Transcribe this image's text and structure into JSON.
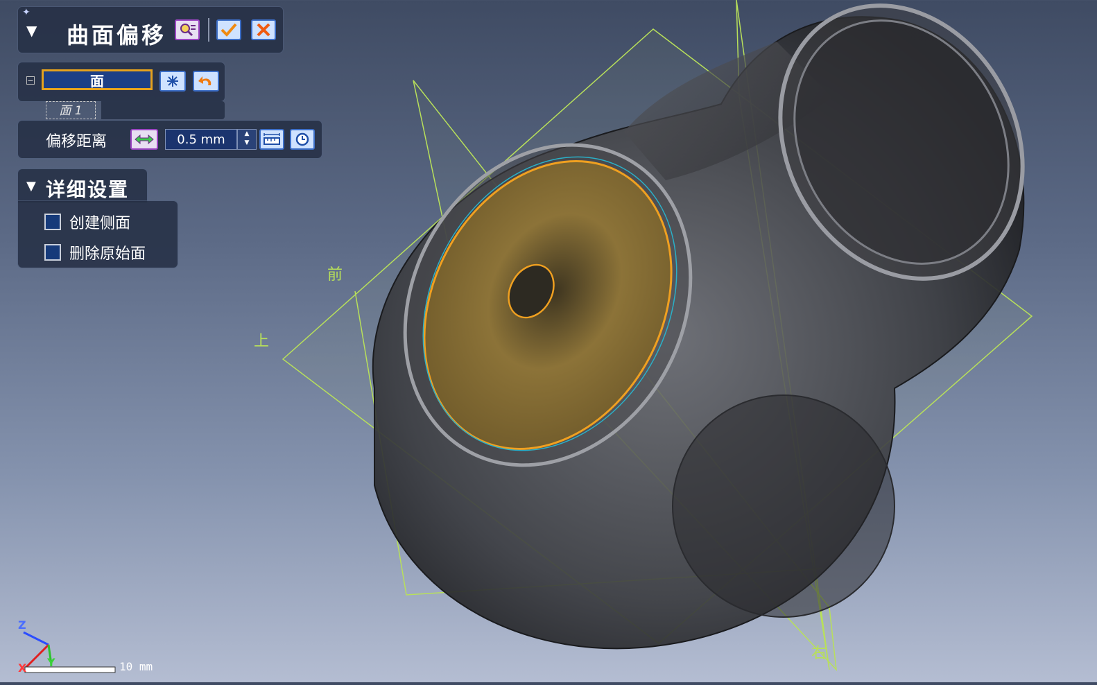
{
  "command": {
    "title": "曲面偏移",
    "preview_icon": "preview-magnifier-icon",
    "ok_icon": "checkmark-icon",
    "cancel_icon": "cancel-x-icon"
  },
  "selection": {
    "field_label": "面",
    "selected_item": "面 1",
    "expand_glyph": "−"
  },
  "offset": {
    "label": "偏移距离",
    "value": "0.5 mm"
  },
  "details": {
    "title": "详细设置",
    "options": [
      {
        "label": "创建侧面",
        "checked": false
      },
      {
        "label": "删除原始面",
        "checked": false
      }
    ]
  },
  "view_labels": {
    "front": "前",
    "top": "上",
    "right": "右"
  },
  "triad": {
    "z": "Z",
    "x": "X",
    "y": "Y"
  },
  "scale_bar": {
    "label": "10  mm"
  },
  "colors": {
    "accent_highlight": "#e6a21d",
    "plane_color": "#b8e05a",
    "field_bg": "#1d3f86"
  }
}
